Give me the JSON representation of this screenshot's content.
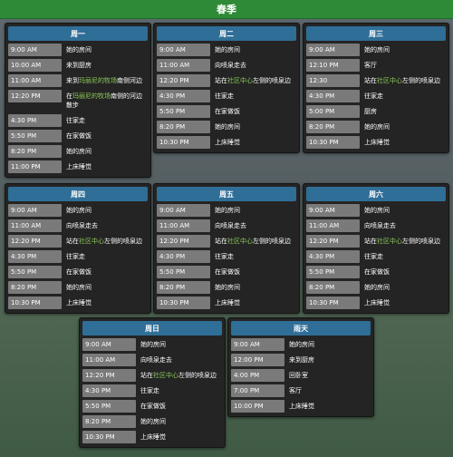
{
  "season": "春季",
  "days": [
    {
      "name": "周一",
      "entries": [
        {
          "time": "9:00 AM",
          "parts": [
            {
              "text": "她的房间",
              "hl": false
            }
          ]
        },
        {
          "time": "10:00 AM",
          "parts": [
            {
              "text": "来到厨房",
              "hl": false
            }
          ]
        },
        {
          "time": "11:00 AM",
          "parts": [
            {
              "text": "来到",
              "hl": false
            },
            {
              "text": "玛丽尼的牧场",
              "hl": true
            },
            {
              "text": "南侧河边",
              "hl": false
            }
          ]
        },
        {
          "time": "12:20 PM",
          "parts": [
            {
              "text": "在",
              "hl": false
            },
            {
              "text": "玛丽尼的牧场",
              "hl": true
            },
            {
              "text": "南侧的河边散步",
              "hl": false
            }
          ]
        },
        {
          "time": "4:30 PM",
          "parts": [
            {
              "text": "往家走",
              "hl": false
            }
          ]
        },
        {
          "time": "5:50 PM",
          "parts": [
            {
              "text": "在家做饭",
              "hl": false
            }
          ]
        },
        {
          "time": "8:20 PM",
          "parts": [
            {
              "text": "她的房间",
              "hl": false
            }
          ]
        },
        {
          "time": "11:00 PM",
          "parts": [
            {
              "text": "上床睡觉",
              "hl": false
            }
          ]
        }
      ]
    },
    {
      "name": "周二",
      "entries": [
        {
          "time": "9:00 AM",
          "parts": [
            {
              "text": "她的房间",
              "hl": false
            }
          ]
        },
        {
          "time": "11:00 AM",
          "parts": [
            {
              "text": "向喷泉走去",
              "hl": false
            }
          ]
        },
        {
          "time": "12:20 PM",
          "parts": [
            {
              "text": "站在",
              "hl": false
            },
            {
              "text": "社区中心",
              "hl": true
            },
            {
              "text": "左侧的喷泉边",
              "hl": false
            }
          ]
        },
        {
          "time": "4:30 PM",
          "parts": [
            {
              "text": "往家走",
              "hl": false
            }
          ]
        },
        {
          "time": "5:50 PM",
          "parts": [
            {
              "text": "在家做饭",
              "hl": false
            }
          ]
        },
        {
          "time": "8:20 PM",
          "parts": [
            {
              "text": "她的房间",
              "hl": false
            }
          ]
        },
        {
          "time": "10:30 PM",
          "parts": [
            {
              "text": "上床睡觉",
              "hl": false
            }
          ]
        }
      ]
    },
    {
      "name": "周三",
      "entries": [
        {
          "time": "9:00 AM",
          "parts": [
            {
              "text": "她的房间",
              "hl": false
            }
          ]
        },
        {
          "time": "12:10 PM",
          "parts": [
            {
              "text": "客厅",
              "hl": false
            }
          ]
        },
        {
          "time": "12:30",
          "parts": [
            {
              "text": "站在",
              "hl": false
            },
            {
              "text": "社区中心",
              "hl": true
            },
            {
              "text": "左侧的喷泉边",
              "hl": false
            }
          ]
        },
        {
          "time": "4:30 PM",
          "parts": [
            {
              "text": "往家走",
              "hl": false
            }
          ]
        },
        {
          "time": "5:00 PM",
          "parts": [
            {
              "text": "厨房",
              "hl": false
            }
          ]
        },
        {
          "time": "8:20 PM",
          "parts": [
            {
              "text": "她的房间",
              "hl": false
            }
          ]
        },
        {
          "time": "10:30 PM",
          "parts": [
            {
              "text": "上床睡觉",
              "hl": false
            }
          ]
        }
      ]
    },
    {
      "name": "周四",
      "entries": [
        {
          "time": "9:00 AM",
          "parts": [
            {
              "text": "她的房间",
              "hl": false
            }
          ]
        },
        {
          "time": "11:00 AM",
          "parts": [
            {
              "text": "向喷泉走去",
              "hl": false
            }
          ]
        },
        {
          "time": "12:20 PM",
          "parts": [
            {
              "text": "站在",
              "hl": false
            },
            {
              "text": "社区中心",
              "hl": true
            },
            {
              "text": "左侧的喷泉边",
              "hl": false
            }
          ]
        },
        {
          "time": "4:30 PM",
          "parts": [
            {
              "text": "往家走",
              "hl": false
            }
          ]
        },
        {
          "time": "5:50 PM",
          "parts": [
            {
              "text": "在家做饭",
              "hl": false
            }
          ]
        },
        {
          "time": "8:20 PM",
          "parts": [
            {
              "text": "她的房间",
              "hl": false
            }
          ]
        },
        {
          "time": "10:30 PM",
          "parts": [
            {
              "text": "上床睡觉",
              "hl": false
            }
          ]
        }
      ]
    },
    {
      "name": "周五",
      "entries": [
        {
          "time": "9:00 AM",
          "parts": [
            {
              "text": "她的房间",
              "hl": false
            }
          ]
        },
        {
          "time": "11:00 AM",
          "parts": [
            {
              "text": "向喷泉走去",
              "hl": false
            }
          ]
        },
        {
          "time": "12:20 PM",
          "parts": [
            {
              "text": "站在",
              "hl": false
            },
            {
              "text": "社区中心",
              "hl": true
            },
            {
              "text": "左侧的喷泉边",
              "hl": false
            }
          ]
        },
        {
          "time": "4:30 PM",
          "parts": [
            {
              "text": "往家走",
              "hl": false
            }
          ]
        },
        {
          "time": "5:50 PM",
          "parts": [
            {
              "text": "在家做饭",
              "hl": false
            }
          ]
        },
        {
          "time": "8:20 PM",
          "parts": [
            {
              "text": "她的房间",
              "hl": false
            }
          ]
        },
        {
          "time": "10:30 PM",
          "parts": [
            {
              "text": "上床睡觉",
              "hl": false
            }
          ]
        }
      ]
    },
    {
      "name": "周六",
      "entries": [
        {
          "time": "9:00 AM",
          "parts": [
            {
              "text": "她的房间",
              "hl": false
            }
          ]
        },
        {
          "time": "11:00 AM",
          "parts": [
            {
              "text": "向喷泉走去",
              "hl": false
            }
          ]
        },
        {
          "time": "12:20 PM",
          "parts": [
            {
              "text": "站在",
              "hl": false
            },
            {
              "text": "社区中心",
              "hl": true
            },
            {
              "text": "左侧的喷泉边",
              "hl": false
            }
          ]
        },
        {
          "time": "4:30 PM",
          "parts": [
            {
              "text": "往家走",
              "hl": false
            }
          ]
        },
        {
          "time": "5:50 PM",
          "parts": [
            {
              "text": "在家做饭",
              "hl": false
            }
          ]
        },
        {
          "time": "8:20 PM",
          "parts": [
            {
              "text": "她的房间",
              "hl": false
            }
          ]
        },
        {
          "time": "10:30 PM",
          "parts": [
            {
              "text": "上床睡觉",
              "hl": false
            }
          ]
        }
      ]
    },
    {
      "name": "周日",
      "entries": [
        {
          "time": "9:00 AM",
          "parts": [
            {
              "text": "她的房间",
              "hl": false
            }
          ]
        },
        {
          "time": "11:00 AM",
          "parts": [
            {
              "text": "向喷泉走去",
              "hl": false
            }
          ]
        },
        {
          "time": "12:20 PM",
          "parts": [
            {
              "text": "站在",
              "hl": false
            },
            {
              "text": "社区中心",
              "hl": true
            },
            {
              "text": "左侧的喷泉边",
              "hl": false
            }
          ]
        },
        {
          "time": "4:30 PM",
          "parts": [
            {
              "text": "往家走",
              "hl": false
            }
          ]
        },
        {
          "time": "5:50 PM",
          "parts": [
            {
              "text": "在家做饭",
              "hl": false
            }
          ]
        },
        {
          "time": "8:20 PM",
          "parts": [
            {
              "text": "她的房间",
              "hl": false
            }
          ]
        },
        {
          "time": "10:30 PM",
          "parts": [
            {
              "text": "上床睡觉",
              "hl": false
            }
          ]
        }
      ]
    },
    {
      "name": "雨天",
      "entries": [
        {
          "time": "9:00 AM",
          "parts": [
            {
              "text": "她的房间",
              "hl": false
            }
          ]
        },
        {
          "time": "12:00 PM",
          "parts": [
            {
              "text": "来到厨房",
              "hl": false
            }
          ]
        },
        {
          "time": "4:00 PM",
          "parts": [
            {
              "text": "回卧室",
              "hl": false
            }
          ]
        },
        {
          "time": "7:00 PM",
          "parts": [
            {
              "text": "客厅",
              "hl": false
            }
          ]
        },
        {
          "time": "10:00 PM",
          "parts": [
            {
              "text": "上床睡觉",
              "hl": false
            }
          ]
        }
      ]
    }
  ],
  "colors": {
    "season_bar": "#2e8a36",
    "panel_header": "#2f6e97",
    "panel_bg": "#242424",
    "time_cell": "#7a7a7a",
    "highlight": "#8fcf5a"
  }
}
